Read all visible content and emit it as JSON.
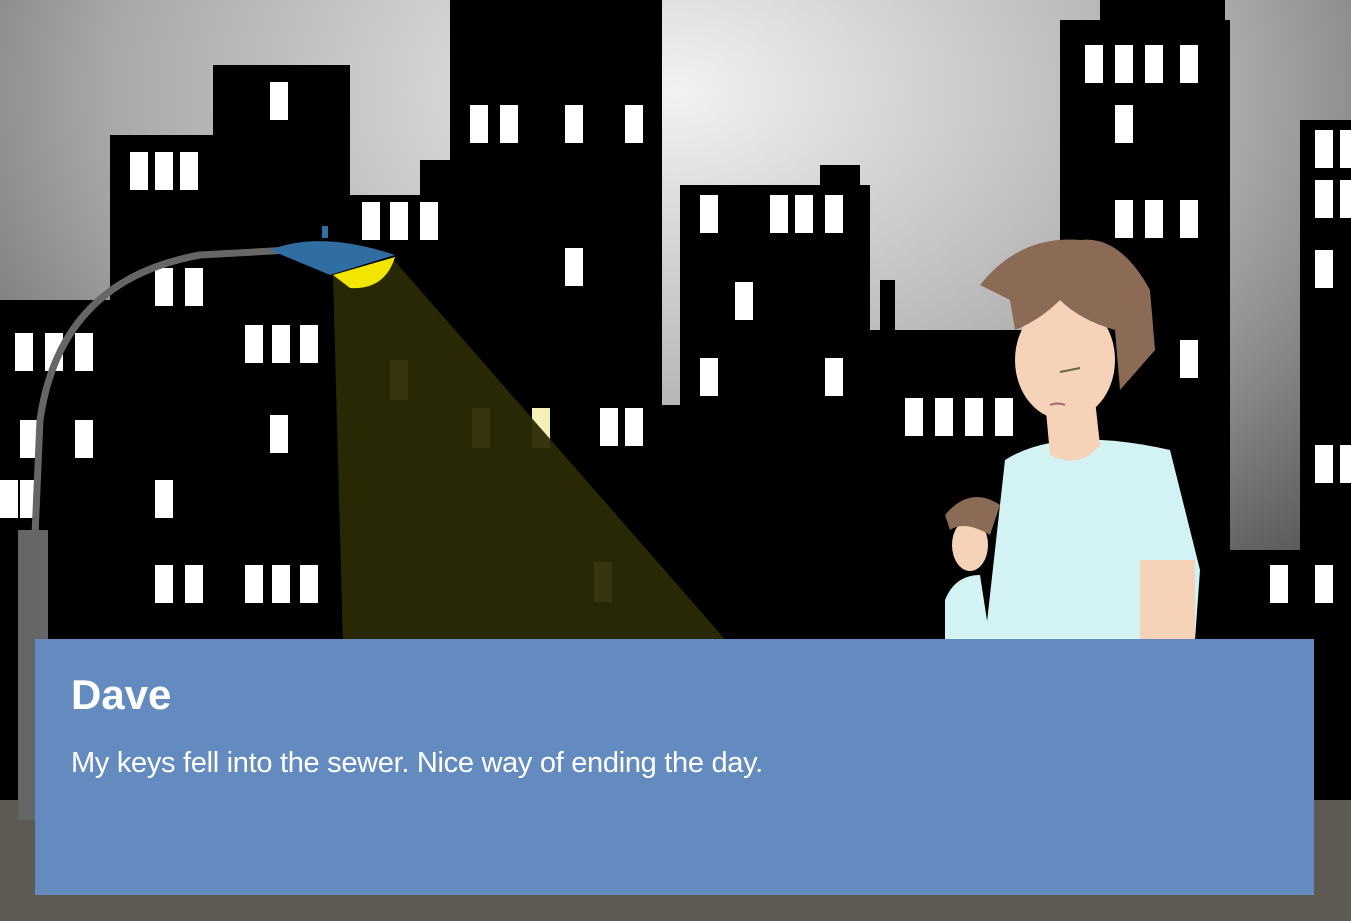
{
  "dialogue": {
    "speaker": "Dave",
    "text": "My keys fell into the sewer. Nice way of ending the day."
  },
  "colors": {
    "dialogue_box": "#648bbf",
    "buildings": "#000000",
    "windows": "#ffffff",
    "lamp_light": "#2b2a05",
    "lamp_bulb": "#f2e500",
    "lamp_shade": "#2f6da3",
    "shirt": "#d3f2f4",
    "hair": "#8b6b55",
    "skin": "#f6d2b8",
    "street": "#5e5a54"
  }
}
